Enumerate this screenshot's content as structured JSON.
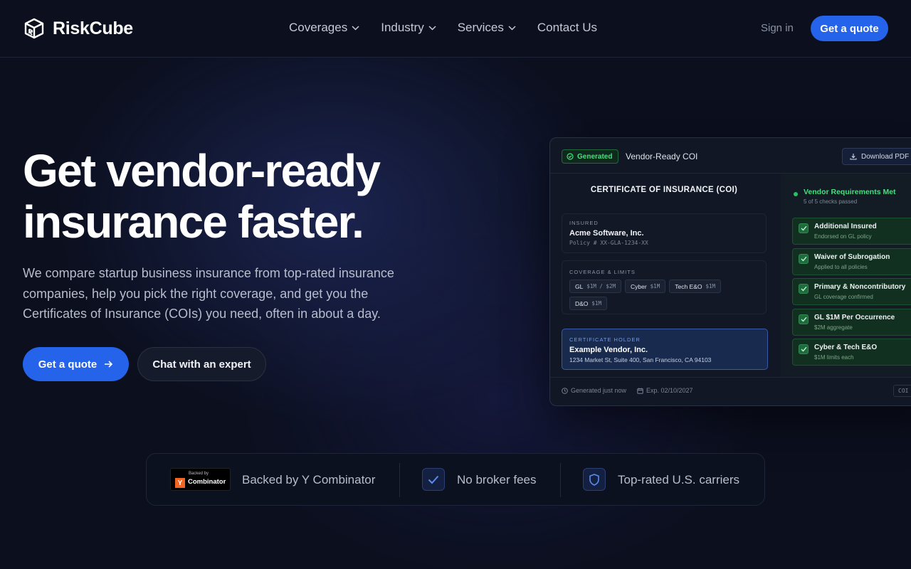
{
  "header": {
    "brand": "RiskCube",
    "nav": [
      {
        "label": "Coverages",
        "has_dropdown": true
      },
      {
        "label": "Industry",
        "has_dropdown": true
      },
      {
        "label": "Services",
        "has_dropdown": true
      },
      {
        "label": "Contact Us",
        "has_dropdown": false
      }
    ],
    "sign_in": "Sign in",
    "get_quote": "Get a quote"
  },
  "hero": {
    "title_line1": "Get vendor-ready",
    "title_line2": "insurance faster.",
    "subtitle": "We compare startup business insurance from top-rated insurance companies, help you pick the right coverage, and get you the Certificates of Insurance (COIs) you need, often in about a day.",
    "primary_cta": "Get a quote",
    "secondary_cta": "Chat with an expert"
  },
  "coi_card": {
    "badge": "Generated",
    "title": "Vendor-Ready COI",
    "download": "Download PDF",
    "heading": "CERTIFICATE OF INSURANCE (COI)",
    "insured_label": "INSURED",
    "insured_name": "Acme Software, Inc.",
    "policy": "Policy # XX-GLA-1234-XX",
    "coverage_label": "COVERAGE & LIMITS",
    "coverages": [
      {
        "name": "GL",
        "limit": "$1M / $2M"
      },
      {
        "name": "Cyber",
        "limit": "$1M"
      },
      {
        "name": "Tech E&O",
        "limit": "$1M"
      },
      {
        "name": "D&O",
        "limit": "$1M"
      }
    ],
    "holder_label": "CERTIFICATE HOLDER",
    "holder_name": "Example Vendor, Inc.",
    "holder_address": "1234 Market St, Suite 400, San Francisco, CA 94103",
    "requirements_title": "Vendor Requirements Met",
    "requirements_sub": "5 of 5 checks passed",
    "checks": [
      {
        "title": "Additional Insured",
        "sub": "Endorsed on GL policy"
      },
      {
        "title": "Waiver of Subrogation",
        "sub": "Applied to all policies"
      },
      {
        "title": "Primary & Noncontributory",
        "sub": "GL coverage confirmed"
      },
      {
        "title": "GL $1M Per Occurrence",
        "sub": "$2M aggregate"
      },
      {
        "title": "Cyber & Tech E&O",
        "sub": "$1M limits each"
      }
    ],
    "footer_generated": "Generated just now",
    "footer_expiry": "Exp. 02/10/2027",
    "footer_tag": "COI"
  },
  "trust": {
    "yc_small": "Backed by",
    "yc_name": "Combinator",
    "yc_letter": "Y",
    "items": [
      "Backed by Y Combinator",
      "No broker fees",
      "Top-rated U.S. carriers"
    ]
  },
  "colors": {
    "background": "#0b0f1e",
    "accent": "#2563eb",
    "success": "#4ade80"
  }
}
